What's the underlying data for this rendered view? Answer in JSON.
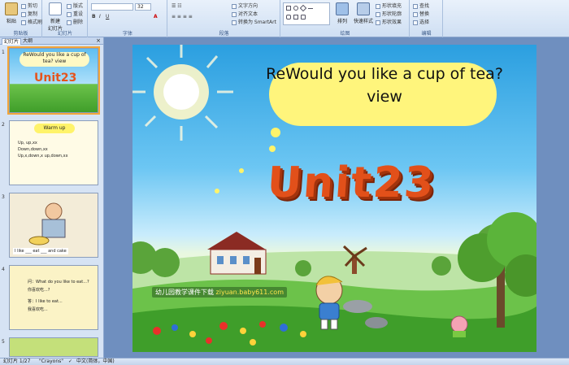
{
  "ribbon": {
    "clipboard": {
      "label": "剪贴板",
      "paste": "粘贴",
      "cut": "剪切",
      "copy": "复制",
      "format_painter": "格式刷"
    },
    "slides": {
      "label": "幻灯片",
      "new_slide": "新建\n幻灯片",
      "layout": "版式",
      "reset": "重设",
      "delete": "删除"
    },
    "font": {
      "label": "字体",
      "size": "32"
    },
    "paragraph": {
      "label": "段落",
      "text_direction": "文字方向",
      "align_text": "对齐文本",
      "smartart": "转换为 SmartArt"
    },
    "drawing": {
      "label": "绘图",
      "arrange": "排列",
      "quick_styles": "快速样式",
      "shape_fill": "形状填充",
      "shape_outline": "形状轮廓",
      "shape_effects": "形状效果"
    },
    "editing": {
      "label": "编辑",
      "find": "查找",
      "replace": "替换",
      "select": "选择"
    }
  },
  "panel": {
    "tabs": [
      "幻灯片",
      "大纲"
    ],
    "close": "×",
    "thumbnails": [
      {
        "num": "1",
        "title": "ReWould you like a cup of tea? view",
        "unit": "Unit23"
      },
      {
        "num": "2",
        "heading": "Warm up",
        "lines": [
          "Up, up,xx",
          "Down,down,xx",
          "Up,x,down,x up,down,xx"
        ]
      },
      {
        "num": "3",
        "caption": "I like ___ eat ___ and cake"
      },
      {
        "num": "4",
        "lines": [
          "问：What do you like to eat...?",
          "你喜欢吃...?",
          "答：I like to eat...",
          "我喜欢吃..."
        ]
      },
      {
        "num": "5"
      }
    ]
  },
  "slide": {
    "title": "ReWould you like a cup of tea?\nview",
    "unit": "Unit23",
    "watermark_prefix": "幼儿园教学课件下载",
    "watermark_url": "ziyuan.baby611.com"
  },
  "status": {
    "slide_counter": "幻灯片 1/27",
    "theme": "\"Crayons\"",
    "language": "中文(简体，中国)"
  },
  "colors": {
    "ribbon_bg": "#dbe7f6",
    "title_cloud": "#fff57c",
    "unit_text": "#e2501a",
    "selection": "#f2a53a"
  }
}
